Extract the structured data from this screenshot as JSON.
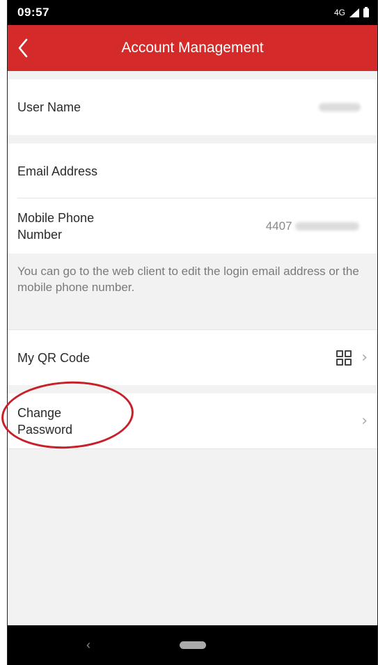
{
  "status_bar": {
    "time": "09:57",
    "network": "4G"
  },
  "header": {
    "title": "Account Management"
  },
  "user_name": {
    "label": "User Name"
  },
  "email": {
    "label": "Email Address"
  },
  "mobile": {
    "label_line1": "Mobile Phone",
    "label_line2": "Number",
    "value_prefix": "4407"
  },
  "hint": {
    "text": "You can go to the web client to edit the login email address or the mobile phone number."
  },
  "qr": {
    "label": "My QR Code"
  },
  "password": {
    "label_line1": "Change",
    "label_line2": "Password"
  },
  "colors": {
    "header_bg": "#d42a2a",
    "annotation": "#c8202a"
  }
}
